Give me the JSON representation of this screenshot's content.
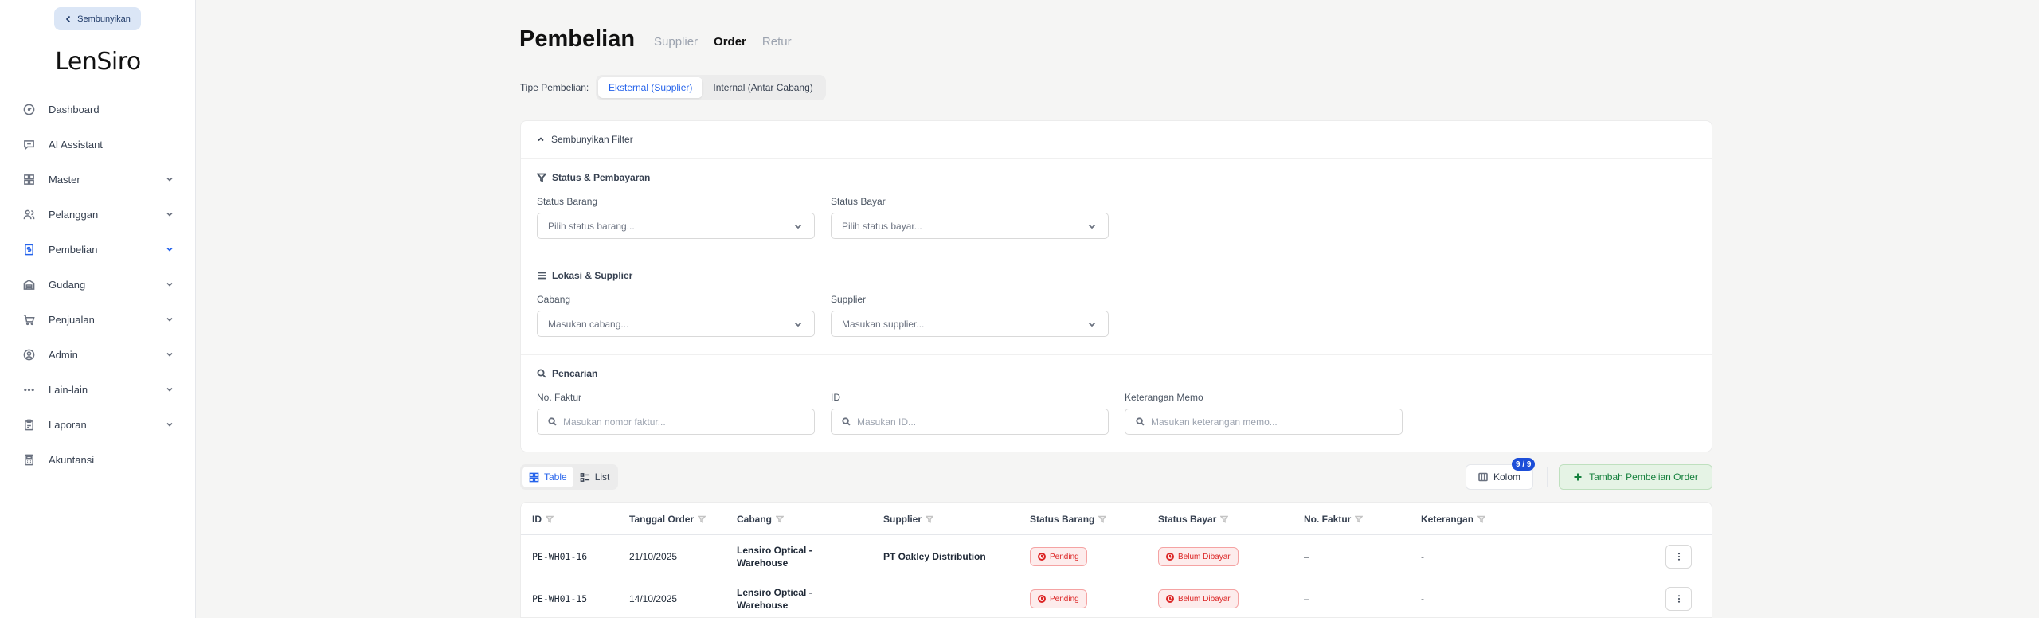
{
  "sidebar": {
    "collapse_label": "Sembunyikan",
    "logo": "LenSiro",
    "items": [
      {
        "label": "Dashboard",
        "icon": "gauge-icon"
      },
      {
        "label": "AI Assistant",
        "icon": "chat-icon"
      },
      {
        "label": "Master",
        "icon": "grid-icon"
      },
      {
        "label": "Pelanggan",
        "icon": "users-icon"
      },
      {
        "label": "Pembelian",
        "icon": "receipt-icon"
      },
      {
        "label": "Gudang",
        "icon": "warehouse-icon"
      },
      {
        "label": "Penjualan",
        "icon": "cart-icon"
      },
      {
        "label": "Admin",
        "icon": "user-circle-icon"
      },
      {
        "label": "Lain-lain",
        "icon": "dots-icon"
      },
      {
        "label": "Laporan",
        "icon": "clipboard-icon"
      },
      {
        "label": "Akuntansi",
        "icon": "calculator-icon"
      }
    ]
  },
  "header": {
    "title": "Pembelian",
    "tabs": [
      "Supplier",
      "Order",
      "Retur"
    ],
    "active_tab": "Order"
  },
  "tipe": {
    "label": "Tipe Pembelian:",
    "options": [
      "Eksternal (Supplier)",
      "Internal (Antar Cabang)"
    ],
    "active": "Eksternal (Supplier)"
  },
  "filter": {
    "toggle_label": "Sembunyikan Filter",
    "status_section": "Status & Pembayaran",
    "status_barang_label": "Status Barang",
    "status_barang_placeholder": "Pilih status barang...",
    "status_bayar_label": "Status Bayar",
    "status_bayar_placeholder": "Pilih status bayar...",
    "lokasi_section": "Lokasi & Supplier",
    "cabang_label": "Cabang",
    "cabang_placeholder": "Masukan cabang...",
    "supplier_label": "Supplier",
    "supplier_placeholder": "Masukan supplier...",
    "search_section": "Pencarian",
    "faktur_label": "No. Faktur",
    "faktur_placeholder": "Masukan nomor faktur...",
    "id_label": "ID",
    "id_placeholder": "Masukan ID...",
    "memo_label": "Keterangan Memo",
    "memo_placeholder": "Masukan keterangan memo..."
  },
  "toolbar": {
    "view_table": "Table",
    "view_list": "List",
    "kolom_label": "Kolom",
    "kolom_badge": "9 / 9",
    "add_label": "Tambah Pembelian Order"
  },
  "table": {
    "columns": [
      "ID",
      "Tanggal Order",
      "Cabang",
      "Supplier",
      "Status Barang",
      "Status Bayar",
      "No. Faktur",
      "Keterangan"
    ],
    "rows": [
      {
        "id": "PE-WH01-16",
        "tanggal": "21/10/2025",
        "cabang_line1": "Lensiro Optical -",
        "cabang_line2": "Warehouse",
        "supplier": "PT Oakley Distribution",
        "status_barang": "Pending",
        "status_bayar": "Belum Dibayar",
        "faktur": "–",
        "keterangan": "-"
      },
      {
        "id": "PE-WH01-15",
        "tanggal": "14/10/2025",
        "cabang_line1": "Lensiro Optical -",
        "cabang_line2": "Warehouse",
        "supplier": "",
        "status_barang": "Pending",
        "status_bayar": "Belum Dibayar",
        "faktur": "–",
        "keterangan": "-"
      }
    ]
  },
  "colors": {
    "accent": "#2563eb",
    "success": "#15803d",
    "danger": "#dc2626",
    "badge": "#1d4ed8"
  }
}
